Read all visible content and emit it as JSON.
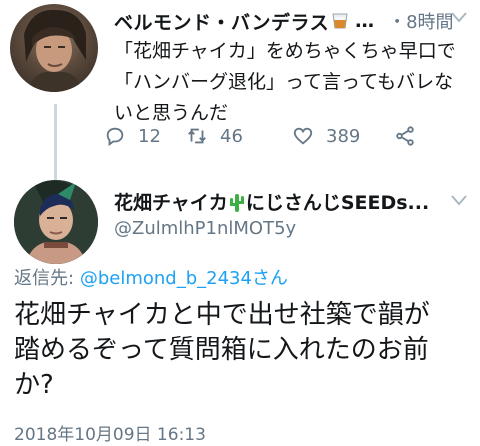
{
  "tweet1": {
    "display_name": "ベルモンド・バンデラス",
    "name_truncation": "…",
    "time": "・8時間",
    "text": "「花畑チャイカ」をめちゃくちゃ早口で\n「ハンバーグ退化」って言ってもバレな\nいと思うんだ",
    "actions": {
      "reply_count": "12",
      "retweet_count": "46",
      "like_count": "389"
    }
  },
  "tweet2": {
    "display_name_part1": "花畑チャイカ",
    "display_name_part2": "にじさんじSEEDs...",
    "handle": "@ZulmlhP1nlMOT5y",
    "reply_label": "返信先:",
    "reply_mention": "@belmond_b_2434さん",
    "text": "花畑チャイカと中で出せ社築で韻が\n踏めるぞって質問箱に入れたのお前\nか?",
    "timestamp": "2018年10月09日 16:13"
  },
  "colors": {
    "text_primary": "#14171a",
    "text_secondary": "#657786",
    "link": "#1da1f2",
    "thread_line": "#cdd7df"
  },
  "icons": [
    "reply-icon",
    "retweet-icon",
    "heart-icon",
    "share-icon",
    "chevron-down-icon",
    "glass-emoji-icon",
    "cactus-emoji-icon"
  ]
}
